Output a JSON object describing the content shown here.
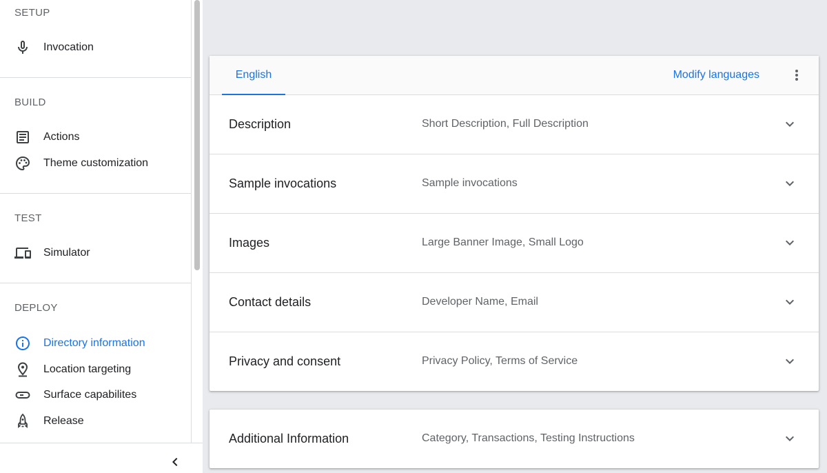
{
  "sidebar": {
    "sections": [
      {
        "title": "SETUP",
        "items": [
          {
            "label": "Invocation",
            "icon": "microphone-icon"
          }
        ]
      },
      {
        "title": "BUILD",
        "items": [
          {
            "label": "Actions",
            "icon": "list-icon"
          },
          {
            "label": "Theme customization",
            "icon": "palette-icon"
          }
        ]
      },
      {
        "title": "TEST",
        "items": [
          {
            "label": "Simulator",
            "icon": "devices-icon"
          }
        ]
      },
      {
        "title": "DEPLOY",
        "items": [
          {
            "label": "Directory information",
            "icon": "info-icon",
            "active": true
          },
          {
            "label": "Location targeting",
            "icon": "location-pin-icon"
          },
          {
            "label": "Surface capabilites",
            "icon": "surface-icon"
          },
          {
            "label": "Release",
            "icon": "rocket-icon"
          }
        ]
      }
    ],
    "collapse_icon": "chevron-left-icon"
  },
  "main": {
    "tab_label": "English",
    "modify_label": "Modify languages",
    "more_icon": "more-vert-icon",
    "rows": [
      {
        "title": "Description",
        "subtitle": "Short Description, Full Description"
      },
      {
        "title": "Sample invocations",
        "subtitle": "Sample invocations"
      },
      {
        "title": "Images",
        "subtitle": "Large Banner Image, Small Logo"
      },
      {
        "title": "Contact details",
        "subtitle": "Developer Name, Email"
      },
      {
        "title": "Privacy and consent",
        "subtitle": "Privacy Policy, Terms of Service"
      }
    ],
    "additional": {
      "title": "Additional Information",
      "subtitle": "Category, Transactions, Testing Instructions"
    }
  },
  "colors": {
    "accent": "#1a73e8",
    "background": "#e8eaed",
    "text_secondary": "#5f6368"
  }
}
